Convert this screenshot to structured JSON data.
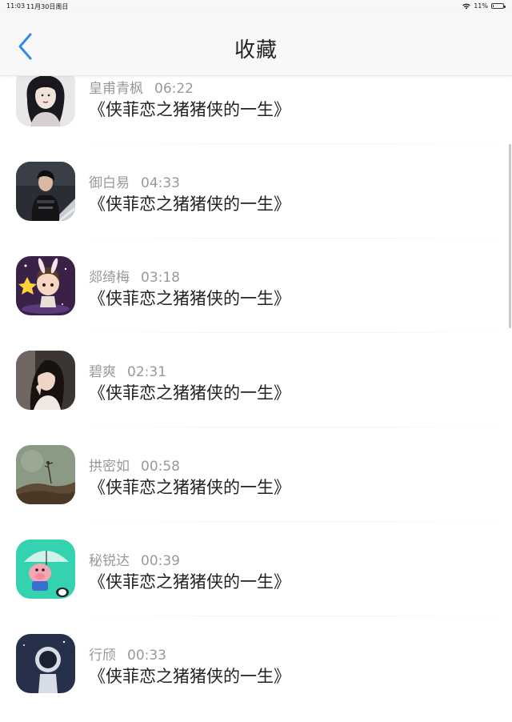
{
  "status_bar": {
    "time": "11:03",
    "date": "11月30日周日",
    "wifi_icon": "wifi-icon",
    "battery_percent": "11%",
    "battery_level": 0.11
  },
  "nav": {
    "back_icon": "chevron-left-icon",
    "title": "收藏"
  },
  "favorites": [
    {
      "author": "皇甫青枫",
      "time": "06:22",
      "title": "《侠菲恋之猪猪侠的一生》"
    },
    {
      "author": "御白易",
      "time": "04:33",
      "title": "《侠菲恋之猪猪侠的一生》"
    },
    {
      "author": "郯绮梅",
      "time": "03:18",
      "title": "《侠菲恋之猪猪侠的一生》"
    },
    {
      "author": "碧爽",
      "time": "02:31",
      "title": "《侠菲恋之猪猪侠的一生》"
    },
    {
      "author": "拱密如",
      "time": "00:58",
      "title": "《侠菲恋之猪猪侠的一生》"
    },
    {
      "author": "秘锐达",
      "time": "00:39",
      "title": "《侠菲恋之猪猪侠的一生》"
    },
    {
      "author": "行颀",
      "time": "00:33",
      "title": "《侠菲恋之猪猪侠的一生》"
    }
  ],
  "colors": {
    "accent": "#2f8ae8",
    "nav_bg": "#f8f8f8",
    "meta_text": "#999999",
    "title_text": "#222222"
  }
}
